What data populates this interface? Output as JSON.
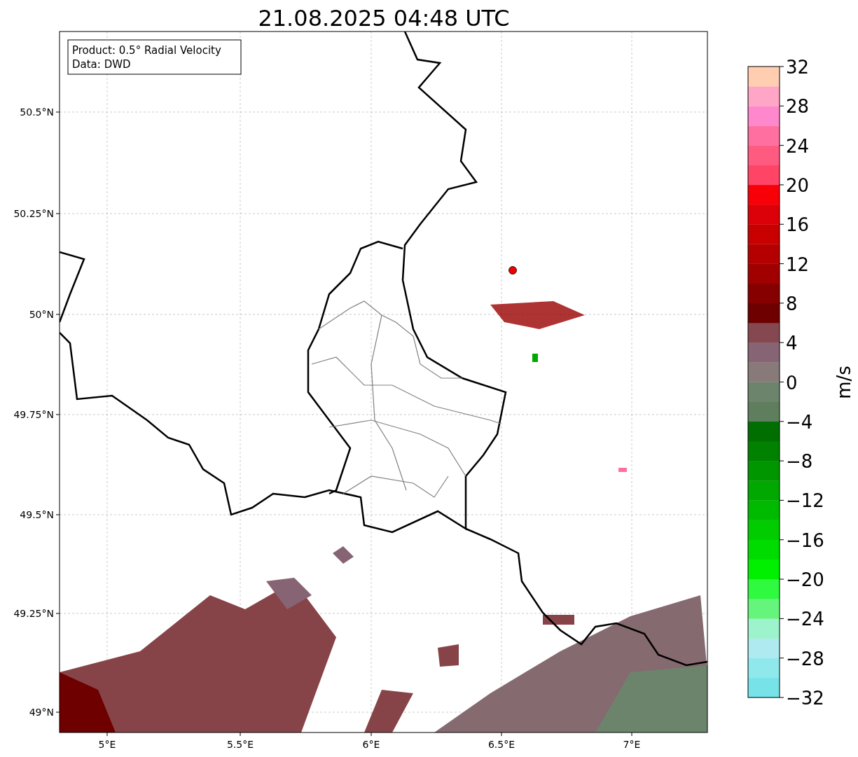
{
  "title": "21.08.2025 04:48 UTC",
  "map": {
    "legend": [
      "Product: 0.5° Radial Velocity",
      "Data: DWD"
    ],
    "lat_ticks": [
      "50.5°N",
      "50.25°N",
      "50°N",
      "49.75°N",
      "49.5°N",
      "49.25°N",
      "49°N"
    ],
    "lon_ticks": [
      "5°E",
      "5.5°E",
      "6°E",
      "6.5°E",
      "7°E"
    ]
  },
  "colorbar": {
    "label": "m/s",
    "ticks": [
      "32",
      "28",
      "24",
      "20",
      "16",
      "12",
      "8",
      "4",
      "0",
      "−4",
      "−8",
      "−12",
      "−16",
      "−20",
      "−24",
      "−28",
      "−32"
    ],
    "bins": [
      {
        "color": "#77e3e8"
      },
      {
        "color": "#8ee8ec"
      },
      {
        "color": "#aeeaef"
      },
      {
        "color": "#9cf3cc"
      },
      {
        "color": "#66f57c"
      },
      {
        "color": "#30fa40"
      },
      {
        "color": "#00f000"
      },
      {
        "color": "#00dc00"
      },
      {
        "color": "#00cc00"
      },
      {
        "color": "#00ba00"
      },
      {
        "color": "#00a800"
      },
      {
        "color": "#009600"
      },
      {
        "color": "#008200"
      },
      {
        "color": "#006e00"
      },
      {
        "color": "#5e7e5e"
      },
      {
        "color": "#6c846c"
      },
      {
        "color": "#887a78"
      },
      {
        "color": "#866474"
      },
      {
        "color": "#864850"
      },
      {
        "color": "#6e0000"
      },
      {
        "color": "#860000"
      },
      {
        "color": "#a00000"
      },
      {
        "color": "#b40000"
      },
      {
        "color": "#c80000"
      },
      {
        "color": "#dc0008"
      },
      {
        "color": "#f80008"
      },
      {
        "color": "#ff4466"
      },
      {
        "color": "#ff5a80"
      },
      {
        "color": "#ff70a0"
      },
      {
        "color": "#ff88cc"
      },
      {
        "color": "#ffa6c6"
      },
      {
        "color": "#ffcdb0"
      }
    ]
  }
}
